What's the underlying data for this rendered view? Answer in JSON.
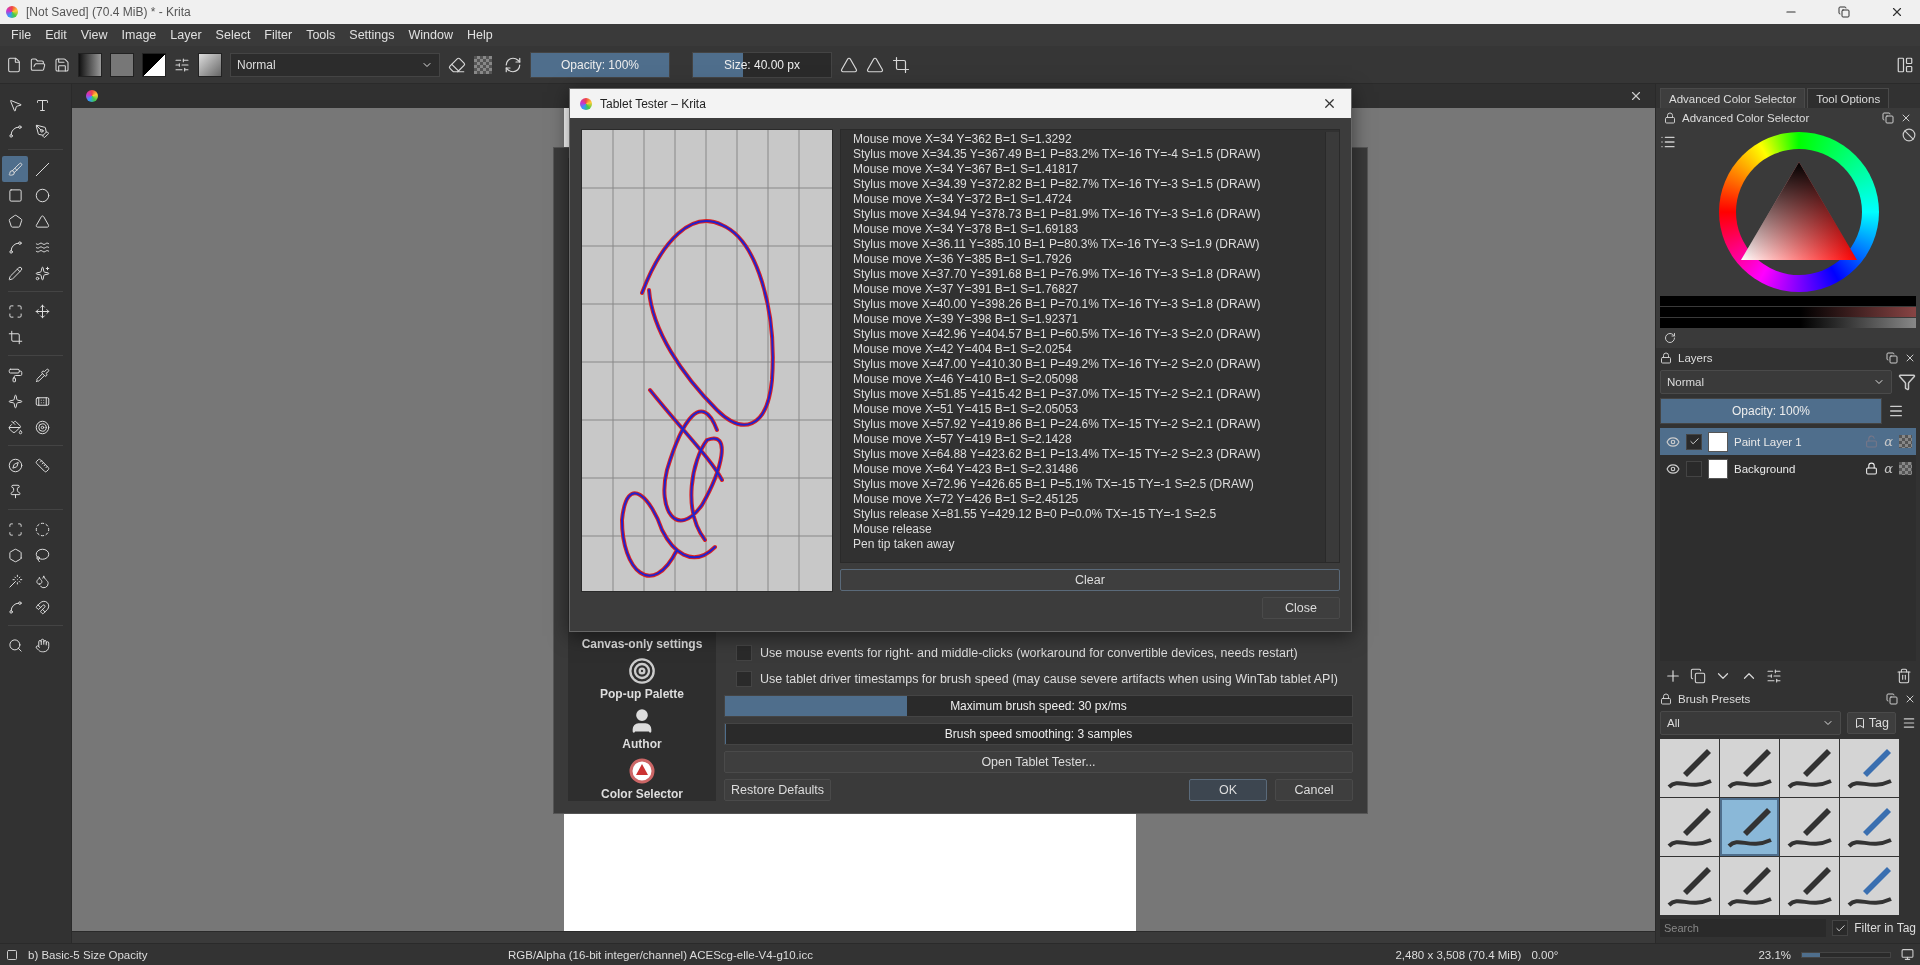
{
  "window": {
    "title": "[Not Saved]  (70.4 MiB) * - Krita"
  },
  "menu": [
    "File",
    "Edit",
    "View",
    "Image",
    "Layer",
    "Select",
    "Filter",
    "Tools",
    "Settings",
    "Window",
    "Help"
  ],
  "toolbar": {
    "blend_mode": "Normal",
    "opacity": {
      "label": "Opacity: 100%",
      "level": 1
    },
    "size": {
      "label": "Size: 40.00 px",
      "level": 0.36
    }
  },
  "tools": [
    {
      "selected": false
    },
    {
      "selected": false
    },
    {
      "selected": false
    },
    {
      "selected": false
    },
    {
      "selected": true
    },
    {
      "selected": false
    },
    {
      "selected": false
    },
    {
      "selected": false
    },
    {
      "selected": false
    },
    {
      "selected": false
    },
    {
      "selected": false
    },
    {
      "selected": false
    },
    {
      "selected": false
    },
    {
      "selected": false
    },
    {
      "selected": false
    },
    {
      "selected": false
    },
    {
      "selected": false
    },
    {
      "selected": false
    },
    {
      "selected": false
    },
    {
      "selected": false
    },
    {
      "selected": false
    },
    {
      "selected": false
    },
    {
      "selected": false
    },
    {
      "selected": false
    },
    {
      "selected": false
    },
    {
      "selected": false
    },
    {
      "selected": false
    },
    {
      "selected": false
    },
    {
      "selected": false
    },
    {
      "selected": false
    },
    {
      "selected": false
    },
    {
      "selected": false
    },
    {
      "selected": false
    },
    {
      "selected": false
    },
    {
      "selected": false
    },
    {
      "selected": false
    }
  ],
  "dockers": {
    "tabs": [
      {
        "label": "Advanced Color Selector",
        "selected": true
      },
      {
        "label": "Tool Options",
        "selected": false
      }
    ],
    "color_selector": {
      "title": "Advanced Color Selector"
    },
    "layers": {
      "title": "Layers",
      "blend_mode": "Normal",
      "opacity": {
        "label": "Opacity:  100%",
        "level": 1
      },
      "items": [
        {
          "name": "Paint Layer 1",
          "selected": true,
          "visible": true,
          "checked": true,
          "locked": false,
          "alpha_toggle": "α"
        },
        {
          "name": "Background",
          "selected": false,
          "visible": true,
          "checked": false,
          "locked": true,
          "alpha_toggle": "α"
        }
      ]
    },
    "brush_presets": {
      "title": "Brush Presets",
      "filter": "All",
      "tag": "Tag",
      "search_placeholder": "Search",
      "filter_in_tag": {
        "label": "Filter in Tag",
        "checked": true
      },
      "items": [
        {
          "selected": false
        },
        {
          "selected": false
        },
        {
          "selected": false
        },
        {
          "selected": false
        },
        {
          "selected": false
        },
        {
          "selected": true
        },
        {
          "selected": false
        },
        {
          "selected": false
        },
        {
          "selected": false
        },
        {
          "selected": false
        },
        {
          "selected": false
        },
        {
          "selected": false
        }
      ]
    }
  },
  "settings_dialog": {
    "pages": [
      {
        "kind": "canvas",
        "label": "Canvas-only settings"
      },
      {
        "kind": "palette",
        "label": "Pop-up Palette"
      },
      {
        "kind": "author",
        "label": "Author"
      },
      {
        "kind": "color",
        "label": "Color Selector"
      }
    ],
    "options": [
      {
        "label": "Use mouse events for right- and middle-clicks (workaround for convertible devices, needs restart)",
        "checked": false
      },
      {
        "label": "Use tablet driver timestamps for brush speed (may cause severe artifacts when using WinTab tablet API)",
        "checked": false
      }
    ],
    "sliders": [
      {
        "label": "Maximum brush speed: 30 px/ms",
        "level": 0.29
      },
      {
        "label": "Brush speed smoothing: 3 samples",
        "level": 0
      }
    ],
    "tester_button": "Open Tablet Tester...",
    "restore_button": "Restore Defaults",
    "ok_button": "OK",
    "cancel_button": "Cancel"
  },
  "tablet_tester": {
    "title": "Tablet Tester – Krita",
    "clear_button": "Clear",
    "close_button": "Close",
    "log": [
      "Mouse move X=34 Y=362 B=1 S=1.3292",
      "Stylus move X=34.35 Y=367.49 B=1 P=83.2% TX=-16 TY=-4 S=1.5 (DRAW)",
      "Mouse move X=34 Y=367 B=1 S=1.41817",
      "Stylus move X=34.39 Y=372.82 B=1 P=82.7% TX=-16 TY=-3 S=1.5 (DRAW)",
      "Mouse move X=34 Y=372 B=1 S=1.4724",
      "Stylus move X=34.94 Y=378.73 B=1 P=81.9% TX=-16 TY=-3 S=1.6 (DRAW)",
      "Mouse move X=34 Y=378 B=1 S=1.69183",
      "Stylus move X=36.11 Y=385.10 B=1 P=80.3% TX=-16 TY=-3 S=1.9 (DRAW)",
      "Mouse move X=36 Y=385 B=1 S=1.7926",
      "Stylus move X=37.70 Y=391.68 B=1 P=76.9% TX=-16 TY=-3 S=1.8 (DRAW)",
      "Mouse move X=37 Y=391 B=1 S=1.76827",
      "Stylus move X=40.00 Y=398.26 B=1 P=70.1% TX=-16 TY=-3 S=1.8 (DRAW)",
      "Mouse move X=39 Y=398 B=1 S=1.92371",
      "Stylus move X=42.96 Y=404.57 B=1 P=60.5% TX=-16 TY=-3 S=2.0 (DRAW)",
      "Mouse move X=42 Y=404 B=1 S=2.0254",
      "Stylus move X=47.00 Y=410.30 B=1 P=49.2% TX=-16 TY=-2 S=2.0 (DRAW)",
      "Mouse move X=46 Y=410 B=1 S=2.05098",
      "Stylus move X=51.85 Y=415.42 B=1 P=37.0% TX=-15 TY=-2 S=2.1 (DRAW)",
      "Mouse move X=51 Y=415 B=1 S=2.05053",
      "Stylus move X=57.92 Y=419.86 B=1 P=24.6% TX=-15 TY=-2 S=2.1 (DRAW)",
      "Mouse move X=57 Y=419 B=1 S=2.1428",
      "Stylus move X=64.88 Y=423.62 B=1 P=13.4% TX=-15 TY=-2 S=2.3 (DRAW)",
      "Mouse move X=64 Y=423 B=1 S=2.31486",
      "Stylus move X=72.96 Y=426.65 B=1 P=5.1% TX=-15 TY=-1 S=2.5 (DRAW)",
      "Mouse move X=72 Y=426 B=1 S=2.45125",
      "Stylus release X=81.55 Y=429.12 B=0 P=0.0% TX=-15 TY=-1 S=2.5",
      "Mouse release",
      "Pen tip taken away"
    ]
  },
  "status_bar": {
    "brush": "b) Basic-5 Size Opacity",
    "color_space": "RGB/Alpha (16-bit integer/channel)  ACEScg-elle-V4-g10.icc",
    "image_size": "2,480 x 3,508 (70.4 MiB)",
    "rotation": "0.00°",
    "zoom": "23.1%",
    "zoom_slider": {
      "level": 0.2
    }
  }
}
